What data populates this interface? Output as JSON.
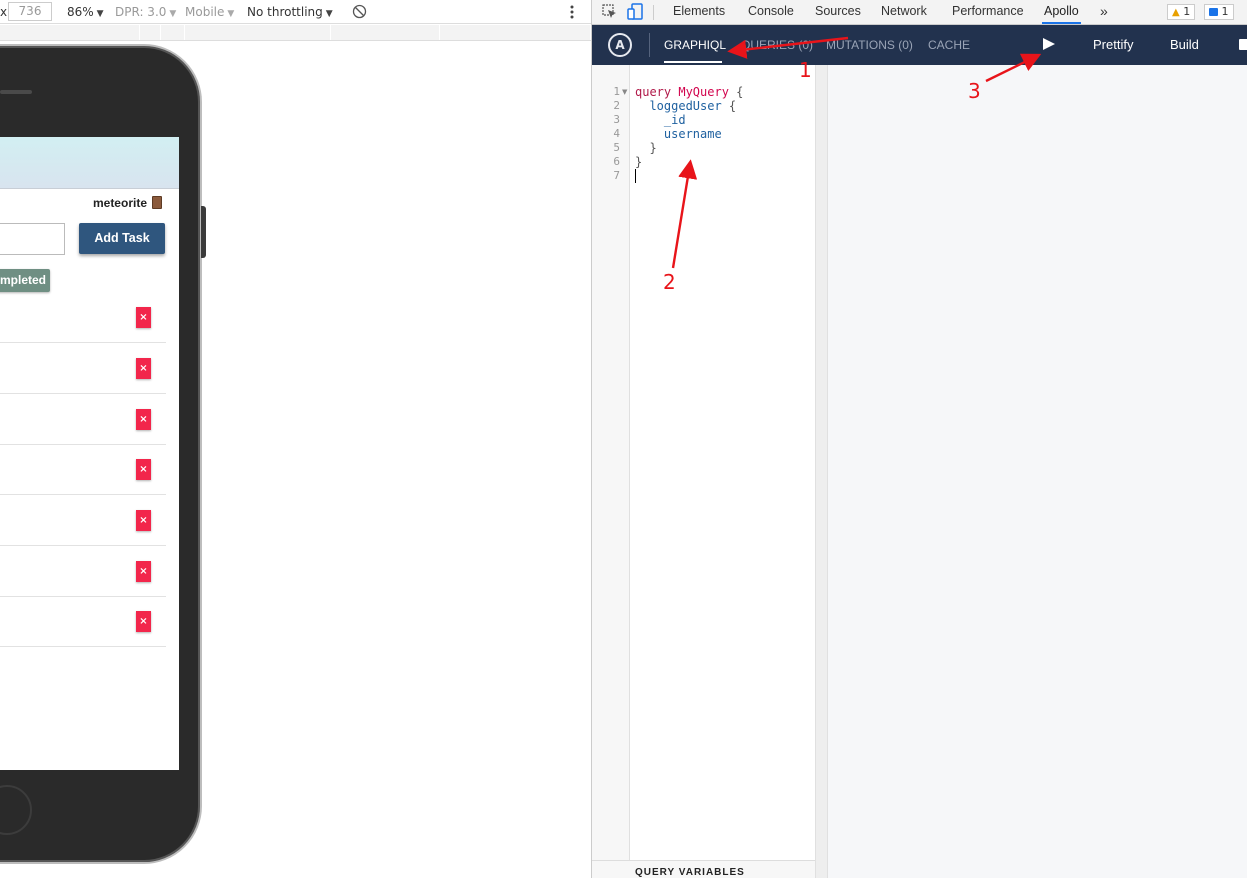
{
  "device_toolbar": {
    "width_value": "736",
    "zoom": "86%",
    "dpr": "DPR: 3.0",
    "mode": "Mobile",
    "throttling": "No throttling"
  },
  "app": {
    "username": "meteorite",
    "add_task_label": "Add Task",
    "hide_completed_label": "mpleted",
    "delete_label": "×"
  },
  "devtools": {
    "tabs": [
      "Elements",
      "Console",
      "Sources",
      "Network",
      "Performance",
      "Apollo"
    ],
    "active_tab": "Apollo",
    "more_tabs": "»",
    "warnings_count": "1",
    "messages_count": "1"
  },
  "apollo": {
    "logo": "A",
    "tabs": [
      "GRAPHIQL",
      "QUERIES (0)",
      "MUTATIONS (0)",
      "CACHE"
    ],
    "active_tab": "GRAPHIQL",
    "prettify_label": "Prettify",
    "build_label": "Build"
  },
  "editor": {
    "line_numbers": [
      "1",
      "2",
      "3",
      "4",
      "5",
      "6",
      "7"
    ],
    "code": {
      "l1_kw": "query",
      "l1_name": "MyQuery",
      "l1_brace": " {",
      "l2_field": "loggedUser",
      "l2_brace": " {",
      "l3_field": "_id",
      "l4_field": "username",
      "l5_brace": "}",
      "l6_brace": "}"
    },
    "query_variables_label": "QUERY VARIABLES"
  },
  "annotations": {
    "labels": [
      "1",
      "2",
      "3"
    ],
    "color": "#e8141a"
  },
  "colors": {
    "apollo_bar": "#22324e",
    "add_task": "#2f567e",
    "delete": "#f2264b",
    "hide_completed": "#6f8f83"
  }
}
